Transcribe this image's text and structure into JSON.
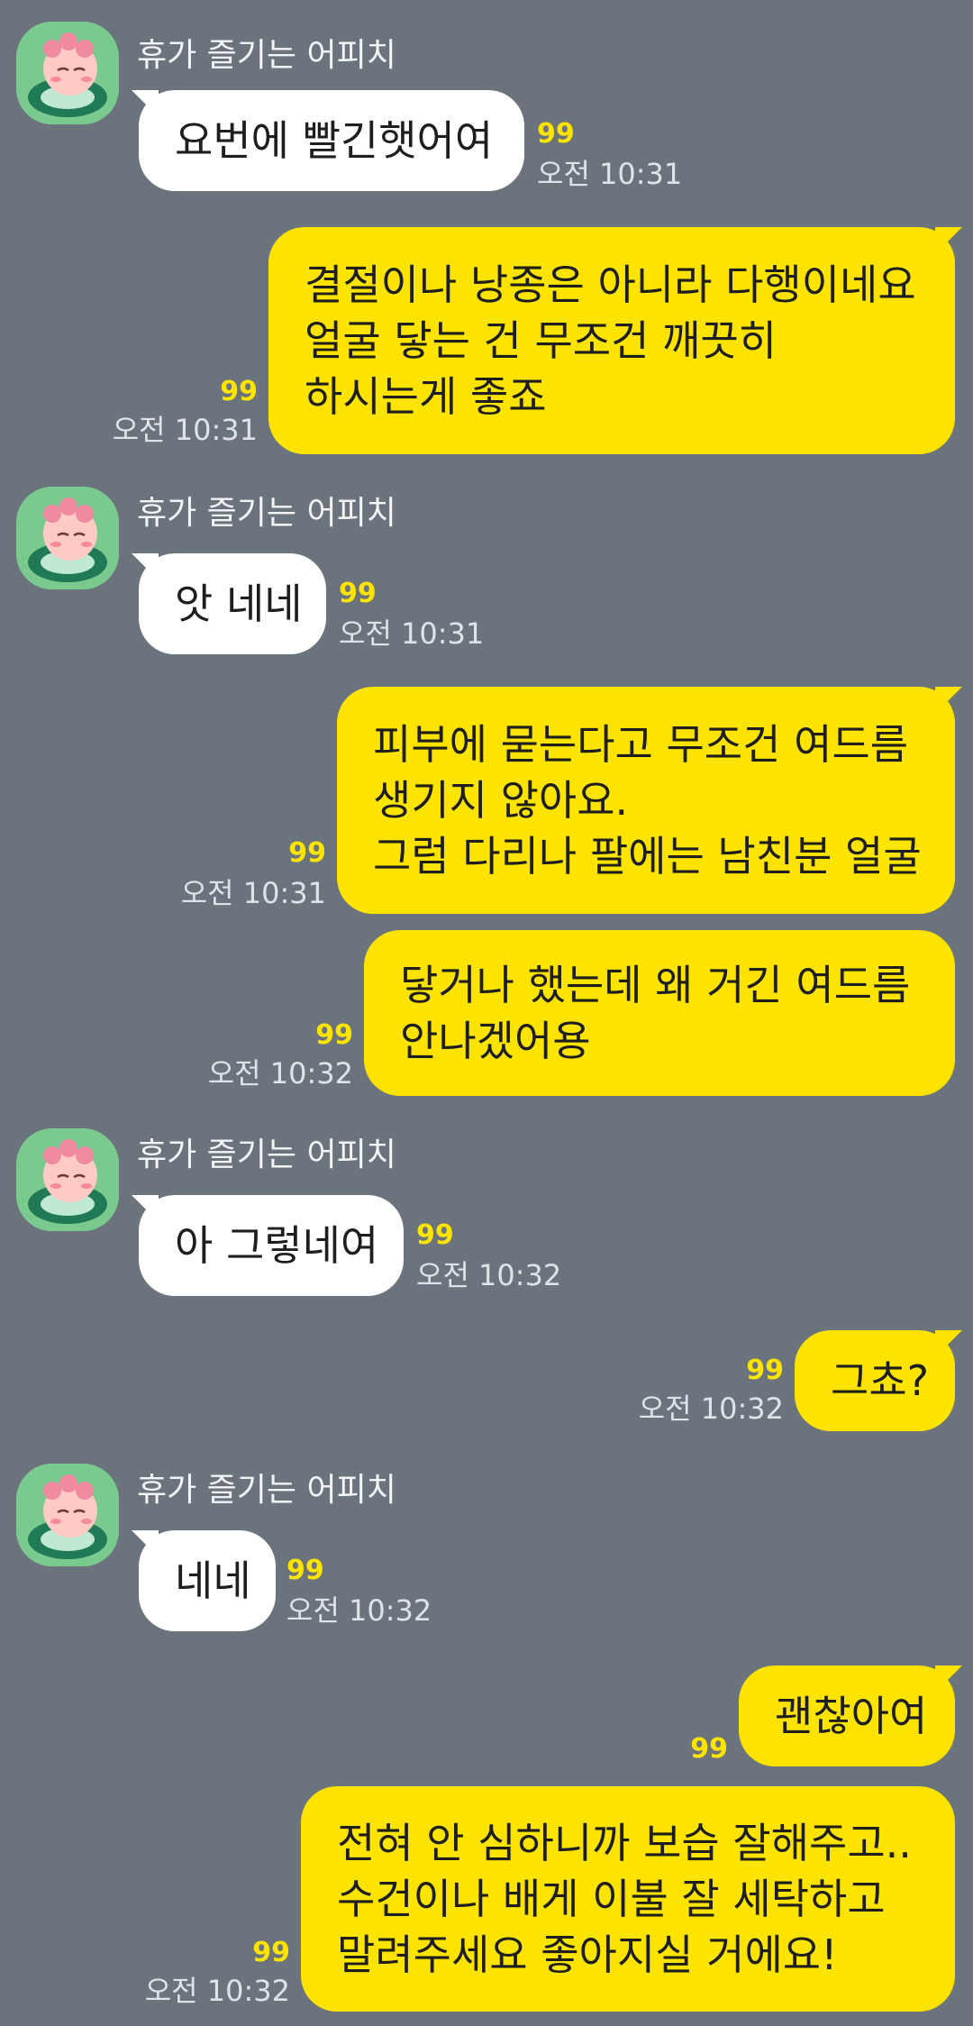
{
  "sender_name": "휴가 즐기는 어피치",
  "unread_marker": "99",
  "messages": [
    {
      "side": "in",
      "sender": "휴가 즐기는 어피치",
      "lines": [
        "요번에 빨긴햇어여"
      ],
      "time": "오전 10:31"
    },
    {
      "side": "out",
      "lines": [
        "결절이나 낭종은 아니라 다행이네요",
        "얼굴 닿는 건 무조건 깨끗히",
        "하시는게 좋죠"
      ],
      "time": "오전 10:31"
    },
    {
      "side": "in",
      "sender": "휴가 즐기는 어피치",
      "lines": [
        "앗 네네"
      ],
      "time": "오전 10:31"
    },
    {
      "side": "out",
      "lines": [
        "피부에 묻는다고 무조건 여드름",
        "생기지 않아요.",
        "그럼 다리나 팔에는 남친분 얼굴"
      ],
      "time": "오전 10:31"
    },
    {
      "side": "out",
      "lines": [
        "닿거나 했는데 왜 거긴 여드름",
        "안나겠어용"
      ],
      "time": "오전 10:32"
    },
    {
      "side": "in",
      "sender": "휴가 즐기는 어피치",
      "lines": [
        "아 그렇네여"
      ],
      "time": "오전 10:32"
    },
    {
      "side": "out",
      "lines": [
        "그쵸?"
      ],
      "time": "오전 10:32"
    },
    {
      "side": "in",
      "sender": "휴가 즐기는 어피치",
      "lines": [
        "네네"
      ],
      "time": "오전 10:32"
    },
    {
      "side": "out",
      "lines": [
        "괜찮아여"
      ],
      "time": ""
    },
    {
      "side": "out",
      "lines": [
        "전혀 안 심하니까 보습 잘해주고..",
        "수건이나 배게 이불 잘 세탁하고",
        "말려주세요 좋아지실 거에요!"
      ],
      "time": "오전 10:32"
    }
  ],
  "colors": {
    "background": "#6b737d",
    "outgoing_bubble": "#fde400",
    "incoming_bubble": "#ffffff",
    "unread": "#fde400"
  },
  "icons": {
    "avatar": "apeach-avatar-icon"
  }
}
